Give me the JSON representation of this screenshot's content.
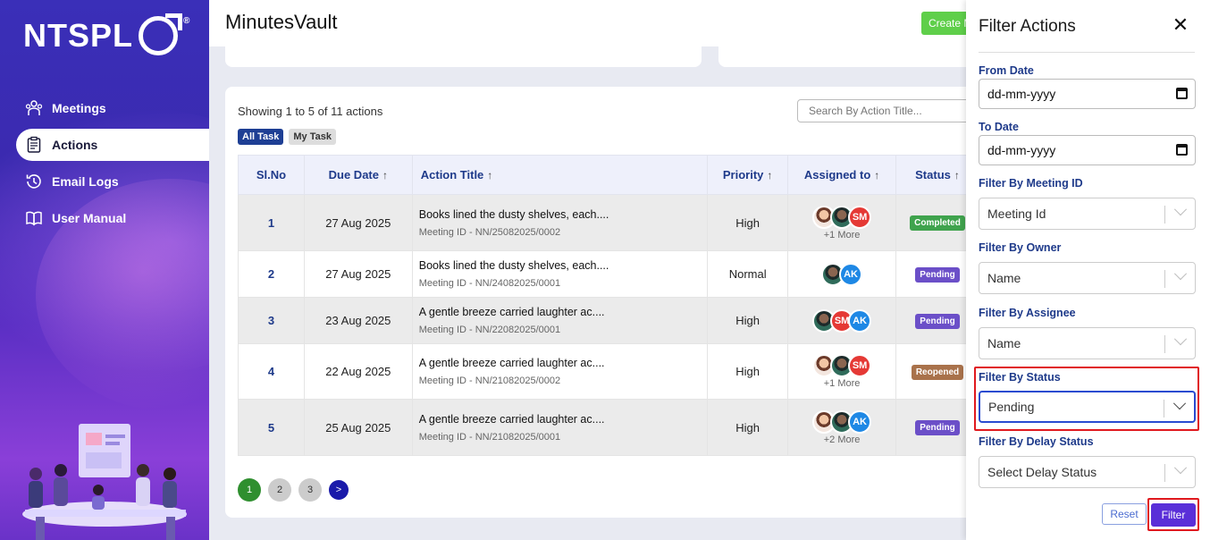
{
  "brand": {
    "name": "NTSPL",
    "reg": "®"
  },
  "sidebar": {
    "items": [
      {
        "label": "Meetings",
        "icon": "meetings-icon",
        "active": false
      },
      {
        "label": "Actions",
        "icon": "clipboard-icon",
        "active": true
      },
      {
        "label": "Email Logs",
        "icon": "history-icon",
        "active": false
      },
      {
        "label": "User Manual",
        "icon": "book-icon",
        "active": false
      }
    ]
  },
  "header": {
    "title": "MinutesVault",
    "create_label": "Create M"
  },
  "list": {
    "showing": "Showing 1 to 5 of 11 actions",
    "search_placeholder": "Search By Action Title...",
    "tabs": [
      "All Task",
      "My Task"
    ],
    "columns": [
      "Sl.No",
      "Due Date",
      "Action Title",
      "Priority",
      "Assigned to",
      "Status"
    ],
    "rows": [
      {
        "sl": "1",
        "due": "27 Aug 2025",
        "title": "Books lined the dusty shelves, each....",
        "meeting": "Meeting ID - NN/25082025/0002",
        "priority": "High",
        "avatars": [
          "photo1",
          "photo2",
          "SM"
        ],
        "more": "+1 More",
        "status": "Completed"
      },
      {
        "sl": "2",
        "due": "27 Aug 2025",
        "title": "Books lined the dusty shelves, each....",
        "meeting": "Meeting ID - NN/24082025/0001",
        "priority": "Normal",
        "avatars": [
          "photo2",
          "AK"
        ],
        "more": "",
        "status": "Pending"
      },
      {
        "sl": "3",
        "due": "23 Aug 2025",
        "title": "A gentle breeze carried laughter ac....",
        "meeting": "Meeting ID - NN/22082025/0001",
        "priority": "High",
        "avatars": [
          "photo2",
          "SM",
          "AK"
        ],
        "more": "",
        "status": "Pending"
      },
      {
        "sl": "4",
        "due": "22 Aug 2025",
        "title": "A gentle breeze carried laughter ac....",
        "meeting": "Meeting ID - NN/21082025/0002",
        "priority": "High",
        "avatars": [
          "photo1",
          "photo2",
          "SM"
        ],
        "more": "+1 More",
        "status": "Reopened"
      },
      {
        "sl": "5",
        "due": "25 Aug 2025",
        "title": "A gentle breeze carried laughter ac....",
        "meeting": "Meeting ID - NN/21082025/0001",
        "priority": "High",
        "avatars": [
          "photo1",
          "photo2",
          "AK"
        ],
        "more": "+2 More",
        "status": "Pending"
      }
    ],
    "pages": [
      "1",
      "2",
      "3"
    ],
    "next": ">"
  },
  "filter": {
    "title": "Filter Actions",
    "close": "✕",
    "from_label": "From Date",
    "from_value": "dd-mm-yyyy",
    "to_label": "To Date",
    "to_value": "dd-mm-yyyy",
    "meeting_label": "Filter By Meeting ID",
    "meeting_value": "Meeting Id",
    "owner_label": "Filter By Owner",
    "owner_value": "Name",
    "assignee_label": "Filter By Assignee",
    "assignee_value": "Name",
    "status_label": "Filter By Status",
    "status_value": "Pending",
    "delay_label": "Filter By Delay Status",
    "delay_value": "Select Delay Status",
    "reset_label": "Reset",
    "filter_label": "Filter"
  },
  "colors": {
    "primary": "#1e3a8a",
    "accent": "#5a2fd8",
    "highlight": "#e0191e"
  }
}
